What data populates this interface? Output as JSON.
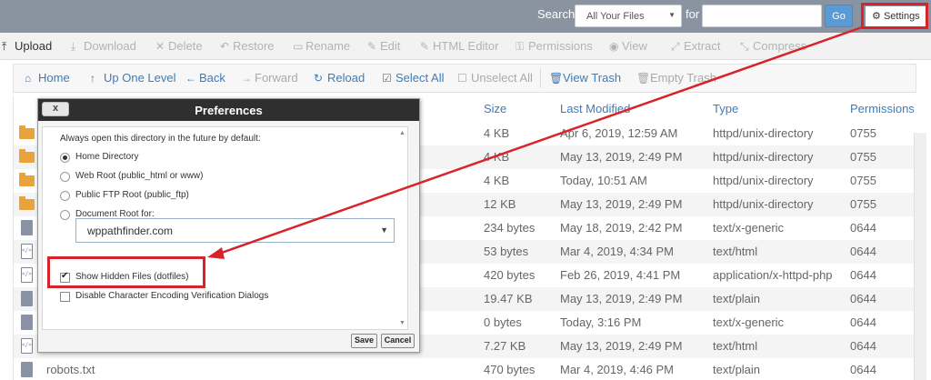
{
  "topbar": {
    "search_label": "Search",
    "scope_value": "All Your Files",
    "for_label": "for",
    "search_value": "",
    "go_label": "Go",
    "settings_label": "Settings",
    "settings_icon": "gear-icon"
  },
  "toolbar": {
    "items": [
      {
        "label": "Upload",
        "icon": "upload-icon"
      },
      {
        "label": "Download",
        "icon": "download-icon"
      },
      {
        "label": "Delete",
        "icon": "delete-icon"
      },
      {
        "label": "Restore",
        "icon": "restore-icon"
      },
      {
        "label": "Rename",
        "icon": "rename-icon"
      },
      {
        "label": "Edit",
        "icon": "edit-icon"
      },
      {
        "label": "HTML Editor",
        "icon": "html-editor-icon"
      },
      {
        "label": "Permissions",
        "icon": "key-icon"
      },
      {
        "label": "View",
        "icon": "eye-icon"
      },
      {
        "label": "Extract",
        "icon": "extract-icon"
      },
      {
        "label": "Compress",
        "icon": "compress-icon"
      }
    ]
  },
  "nav": {
    "items": [
      {
        "label": "Home",
        "icon": "home-icon"
      },
      {
        "label": "Up One Level",
        "icon": "level-up-icon"
      },
      {
        "label": "Back",
        "icon": "arrow-left-icon"
      },
      {
        "label": "Forward",
        "icon": "arrow-right-icon"
      },
      {
        "label": "Reload",
        "icon": "reload-icon"
      },
      {
        "label": "Select All",
        "icon": "checkbox-checked-icon"
      },
      {
        "label": "Unselect All",
        "icon": "checkbox-empty-icon"
      },
      {
        "label": "View Trash",
        "icon": "trash-icon"
      },
      {
        "label": "Empty Trash",
        "icon": "trash-icon"
      }
    ]
  },
  "table": {
    "columns": [
      "Size",
      "Last Modified",
      "Type",
      "Permissions"
    ],
    "rows": [
      {
        "name": "",
        "size": "4 KB",
        "modified": "Apr 6, 2019, 12:59 AM",
        "type": "httpd/unix-directory",
        "perms": "0755",
        "icon": "folder-icon"
      },
      {
        "name": "",
        "size": "4 KB",
        "modified": "May 13, 2019, 2:49 PM",
        "type": "httpd/unix-directory",
        "perms": "0755",
        "icon": "folder-icon"
      },
      {
        "name": "",
        "size": "4 KB",
        "modified": "Today, 10:51 AM",
        "type": "httpd/unix-directory",
        "perms": "0755",
        "icon": "folder-icon"
      },
      {
        "name": "",
        "size": "12 KB",
        "modified": "May 13, 2019, 2:49 PM",
        "type": "httpd/unix-directory",
        "perms": "0755",
        "icon": "folder-icon"
      },
      {
        "name": "",
        "size": "234 bytes",
        "modified": "May 18, 2019, 2:42 PM",
        "type": "text/x-generic",
        "perms": "0644",
        "icon": "file-icon"
      },
      {
        "name": "",
        "size": "53 bytes",
        "modified": "Mar 4, 2019, 4:34 PM",
        "type": "text/html",
        "perms": "0644",
        "icon": "code-file-icon"
      },
      {
        "name": "",
        "size": "420 bytes",
        "modified": "Feb 26, 2019, 4:41 PM",
        "type": "application/x-httpd-php",
        "perms": "0644",
        "icon": "code-file-icon"
      },
      {
        "name": "",
        "size": "19.47 KB",
        "modified": "May 13, 2019, 2:49 PM",
        "type": "text/plain",
        "perms": "0644",
        "icon": "file-icon"
      },
      {
        "name": "",
        "size": "0 bytes",
        "modified": "Today, 3:16 PM",
        "type": "text/x-generic",
        "perms": "0644",
        "icon": "file-icon"
      },
      {
        "name": "",
        "size": "7.27 KB",
        "modified": "May 13, 2019, 2:49 PM",
        "type": "text/html",
        "perms": "0644",
        "icon": "code-file-icon"
      },
      {
        "name": "robots.txt",
        "size": "470 bytes",
        "modified": "Mar 4, 2019, 4:46 PM",
        "type": "text/plain",
        "perms": "0644",
        "icon": "file-icon"
      }
    ]
  },
  "dialog": {
    "title": "Preferences",
    "close_label": "x",
    "intro": "Always open this directory in the future by default:",
    "options": [
      {
        "label": "Home Directory",
        "selected": true
      },
      {
        "label": "Web Root (public_html or www)",
        "selected": false
      },
      {
        "label": "Public FTP Root (public_ftp)",
        "selected": false
      },
      {
        "label": "Document Root for:",
        "selected": false
      }
    ],
    "docroot_value": "wppathfinder.com",
    "show_hidden_label": "Show Hidden Files (dotfiles)",
    "show_hidden_checked": true,
    "disable_encoding_label": "Disable Character Encoding Verification Dialogs",
    "disable_encoding_checked": false,
    "save_label": "Save",
    "cancel_label": "Cancel"
  },
  "colors": {
    "topbar": "#8a93a0",
    "link": "#3e7cb8",
    "highlight": "#d9232a",
    "folder": "#e8a33d"
  }
}
